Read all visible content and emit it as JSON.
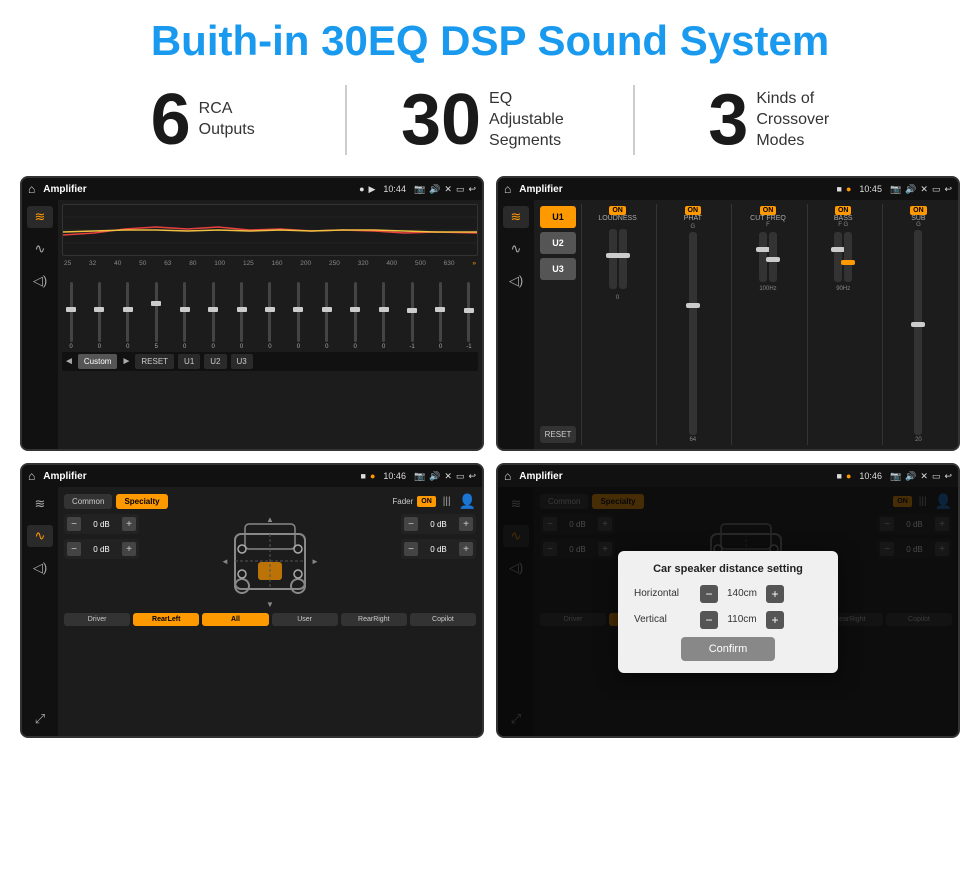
{
  "page": {
    "title": "Buith-in 30EQ DSP Sound System"
  },
  "stats": [
    {
      "number": "6",
      "text": "RCA\nOutputs"
    },
    {
      "number": "30",
      "text": "EQ Adjustable\nSegments"
    },
    {
      "number": "3",
      "text": "Kinds of\nCrossover Modes"
    }
  ],
  "screens": {
    "screen1": {
      "status": {
        "title": "Amplifier",
        "time": "10:44"
      },
      "eq_frequencies": [
        "25",
        "32",
        "40",
        "50",
        "63",
        "80",
        "100",
        "125",
        "160",
        "200",
        "250",
        "320",
        "400",
        "500",
        "630"
      ],
      "eq_values": [
        "0",
        "0",
        "0",
        "5",
        "0",
        "0",
        "0",
        "0",
        "0",
        "0",
        "0",
        "0",
        "-1",
        "0",
        "-1"
      ],
      "buttons": [
        "Custom",
        "RESET",
        "U1",
        "U2",
        "U3"
      ]
    },
    "screen2": {
      "status": {
        "title": "Amplifier",
        "time": "10:45"
      },
      "channels": [
        "LOUDNESS",
        "PHAT",
        "CUT FREQ",
        "BASS",
        "SUB"
      ],
      "u_buttons": [
        "U1",
        "U2",
        "U3"
      ],
      "reset_label": "RESET"
    },
    "screen3": {
      "status": {
        "title": "Amplifier",
        "time": "10:46"
      },
      "tabs": [
        "Common",
        "Specialty"
      ],
      "fader_label": "Fader",
      "on_label": "ON",
      "db_values": [
        "0 dB",
        "0 dB",
        "0 dB",
        "0 dB"
      ],
      "buttons": [
        "Driver",
        "RearLeft",
        "All",
        "User",
        "RearRight",
        "Copilot"
      ]
    },
    "screen4": {
      "status": {
        "title": "Amplifier",
        "time": "10:46"
      },
      "tabs": [
        "Common",
        "Specialty"
      ],
      "on_label": "ON",
      "dialog": {
        "title": "Car speaker distance setting",
        "horizontal_label": "Horizontal",
        "horizontal_value": "140cm",
        "vertical_label": "Vertical",
        "vertical_value": "110cm",
        "confirm_label": "Confirm",
        "db_right_1": "0 dB",
        "db_right_2": "0 dB"
      },
      "buttons": [
        "Driver",
        "RearLeft.",
        "All",
        "User",
        "RearRight",
        "Copilot"
      ]
    }
  }
}
